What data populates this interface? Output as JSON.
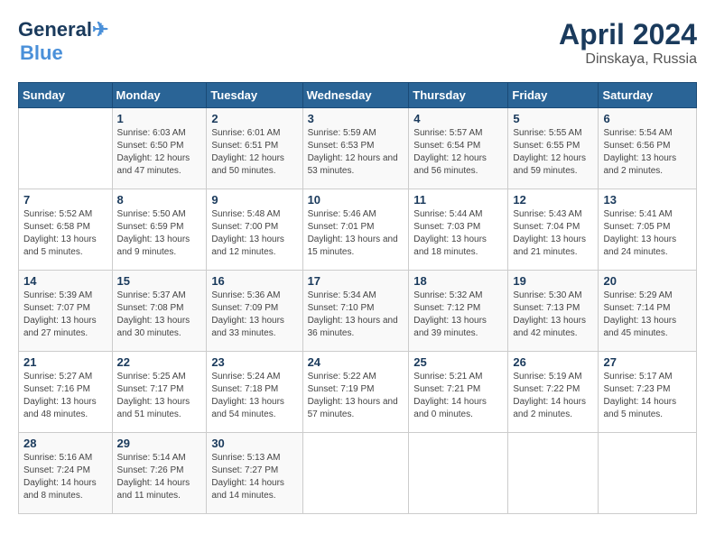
{
  "header": {
    "logo_line1": "General",
    "logo_line2": "Blue",
    "title": "April 2024",
    "subtitle": "Dinskaya, Russia"
  },
  "days_of_week": [
    "Sunday",
    "Monday",
    "Tuesday",
    "Wednesday",
    "Thursday",
    "Friday",
    "Saturday"
  ],
  "weeks": [
    [
      {
        "num": "",
        "sunrise": "",
        "sunset": "",
        "daylight": ""
      },
      {
        "num": "1",
        "sunrise": "Sunrise: 6:03 AM",
        "sunset": "Sunset: 6:50 PM",
        "daylight": "Daylight: 12 hours and 47 minutes."
      },
      {
        "num": "2",
        "sunrise": "Sunrise: 6:01 AM",
        "sunset": "Sunset: 6:51 PM",
        "daylight": "Daylight: 12 hours and 50 minutes."
      },
      {
        "num": "3",
        "sunrise": "Sunrise: 5:59 AM",
        "sunset": "Sunset: 6:53 PM",
        "daylight": "Daylight: 12 hours and 53 minutes."
      },
      {
        "num": "4",
        "sunrise": "Sunrise: 5:57 AM",
        "sunset": "Sunset: 6:54 PM",
        "daylight": "Daylight: 12 hours and 56 minutes."
      },
      {
        "num": "5",
        "sunrise": "Sunrise: 5:55 AM",
        "sunset": "Sunset: 6:55 PM",
        "daylight": "Daylight: 12 hours and 59 minutes."
      },
      {
        "num": "6",
        "sunrise": "Sunrise: 5:54 AM",
        "sunset": "Sunset: 6:56 PM",
        "daylight": "Daylight: 13 hours and 2 minutes."
      }
    ],
    [
      {
        "num": "7",
        "sunrise": "Sunrise: 5:52 AM",
        "sunset": "Sunset: 6:58 PM",
        "daylight": "Daylight: 13 hours and 5 minutes."
      },
      {
        "num": "8",
        "sunrise": "Sunrise: 5:50 AM",
        "sunset": "Sunset: 6:59 PM",
        "daylight": "Daylight: 13 hours and 9 minutes."
      },
      {
        "num": "9",
        "sunrise": "Sunrise: 5:48 AM",
        "sunset": "Sunset: 7:00 PM",
        "daylight": "Daylight: 13 hours and 12 minutes."
      },
      {
        "num": "10",
        "sunrise": "Sunrise: 5:46 AM",
        "sunset": "Sunset: 7:01 PM",
        "daylight": "Daylight: 13 hours and 15 minutes."
      },
      {
        "num": "11",
        "sunrise": "Sunrise: 5:44 AM",
        "sunset": "Sunset: 7:03 PM",
        "daylight": "Daylight: 13 hours and 18 minutes."
      },
      {
        "num": "12",
        "sunrise": "Sunrise: 5:43 AM",
        "sunset": "Sunset: 7:04 PM",
        "daylight": "Daylight: 13 hours and 21 minutes."
      },
      {
        "num": "13",
        "sunrise": "Sunrise: 5:41 AM",
        "sunset": "Sunset: 7:05 PM",
        "daylight": "Daylight: 13 hours and 24 minutes."
      }
    ],
    [
      {
        "num": "14",
        "sunrise": "Sunrise: 5:39 AM",
        "sunset": "Sunset: 7:07 PM",
        "daylight": "Daylight: 13 hours and 27 minutes."
      },
      {
        "num": "15",
        "sunrise": "Sunrise: 5:37 AM",
        "sunset": "Sunset: 7:08 PM",
        "daylight": "Daylight: 13 hours and 30 minutes."
      },
      {
        "num": "16",
        "sunrise": "Sunrise: 5:36 AM",
        "sunset": "Sunset: 7:09 PM",
        "daylight": "Daylight: 13 hours and 33 minutes."
      },
      {
        "num": "17",
        "sunrise": "Sunrise: 5:34 AM",
        "sunset": "Sunset: 7:10 PM",
        "daylight": "Daylight: 13 hours and 36 minutes."
      },
      {
        "num": "18",
        "sunrise": "Sunrise: 5:32 AM",
        "sunset": "Sunset: 7:12 PM",
        "daylight": "Daylight: 13 hours and 39 minutes."
      },
      {
        "num": "19",
        "sunrise": "Sunrise: 5:30 AM",
        "sunset": "Sunset: 7:13 PM",
        "daylight": "Daylight: 13 hours and 42 minutes."
      },
      {
        "num": "20",
        "sunrise": "Sunrise: 5:29 AM",
        "sunset": "Sunset: 7:14 PM",
        "daylight": "Daylight: 13 hours and 45 minutes."
      }
    ],
    [
      {
        "num": "21",
        "sunrise": "Sunrise: 5:27 AM",
        "sunset": "Sunset: 7:16 PM",
        "daylight": "Daylight: 13 hours and 48 minutes."
      },
      {
        "num": "22",
        "sunrise": "Sunrise: 5:25 AM",
        "sunset": "Sunset: 7:17 PM",
        "daylight": "Daylight: 13 hours and 51 minutes."
      },
      {
        "num": "23",
        "sunrise": "Sunrise: 5:24 AM",
        "sunset": "Sunset: 7:18 PM",
        "daylight": "Daylight: 13 hours and 54 minutes."
      },
      {
        "num": "24",
        "sunrise": "Sunrise: 5:22 AM",
        "sunset": "Sunset: 7:19 PM",
        "daylight": "Daylight: 13 hours and 57 minutes."
      },
      {
        "num": "25",
        "sunrise": "Sunrise: 5:21 AM",
        "sunset": "Sunset: 7:21 PM",
        "daylight": "Daylight: 14 hours and 0 minutes."
      },
      {
        "num": "26",
        "sunrise": "Sunrise: 5:19 AM",
        "sunset": "Sunset: 7:22 PM",
        "daylight": "Daylight: 14 hours and 2 minutes."
      },
      {
        "num": "27",
        "sunrise": "Sunrise: 5:17 AM",
        "sunset": "Sunset: 7:23 PM",
        "daylight": "Daylight: 14 hours and 5 minutes."
      }
    ],
    [
      {
        "num": "28",
        "sunrise": "Sunrise: 5:16 AM",
        "sunset": "Sunset: 7:24 PM",
        "daylight": "Daylight: 14 hours and 8 minutes."
      },
      {
        "num": "29",
        "sunrise": "Sunrise: 5:14 AM",
        "sunset": "Sunset: 7:26 PM",
        "daylight": "Daylight: 14 hours and 11 minutes."
      },
      {
        "num": "30",
        "sunrise": "Sunrise: 5:13 AM",
        "sunset": "Sunset: 7:27 PM",
        "daylight": "Daylight: 14 hours and 14 minutes."
      },
      {
        "num": "",
        "sunrise": "",
        "sunset": "",
        "daylight": ""
      },
      {
        "num": "",
        "sunrise": "",
        "sunset": "",
        "daylight": ""
      },
      {
        "num": "",
        "sunrise": "",
        "sunset": "",
        "daylight": ""
      },
      {
        "num": "",
        "sunrise": "",
        "sunset": "",
        "daylight": ""
      }
    ]
  ]
}
